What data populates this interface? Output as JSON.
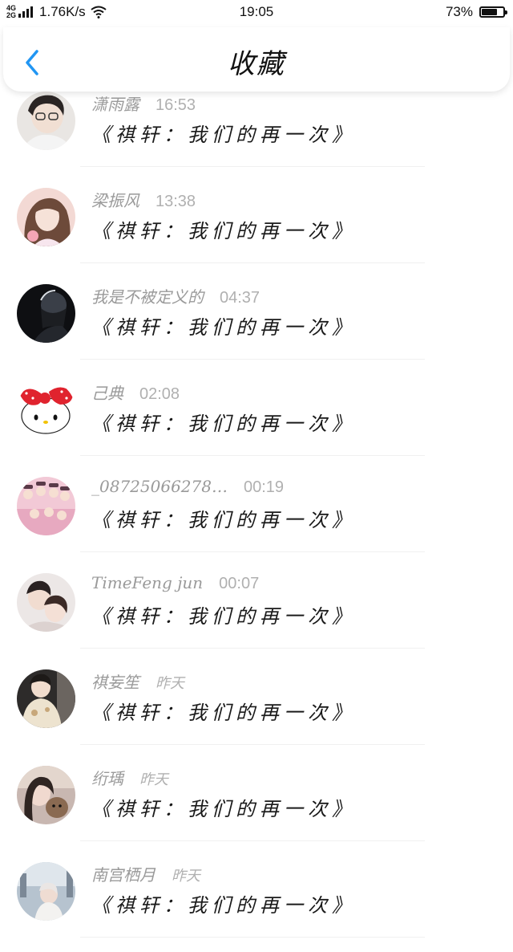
{
  "status_bar": {
    "network_top": "4G",
    "network_bottom": "2G",
    "speed": "1.76K/s",
    "time": "19:05",
    "battery_percent": "73%",
    "battery_level": 0.73
  },
  "header": {
    "title": "收藏",
    "accent_color": "#2196F3"
  },
  "items": [
    {
      "name": "潇雨露",
      "time": "16:53",
      "title": "《祺轩：我们的再一次》",
      "avatar": "avatar-boy-glasses"
    },
    {
      "name": "梁振风",
      "time": "13:38",
      "title": "《祺轩：我们的再一次》",
      "avatar": "avatar-girl-pink"
    },
    {
      "name": "我是不被定义的",
      "time": "04:37",
      "title": "《祺轩：我们的再一次》",
      "avatar": "avatar-dark-silhouette"
    },
    {
      "name": "己典",
      "time": "02:08",
      "title": "《祺轩：我们的再一次》",
      "avatar": "avatar-hello-kitty"
    },
    {
      "name": "_08725066278…",
      "time": "00:19",
      "title": "《祺轩：我们的再一次》",
      "avatar": "avatar-group-pink"
    },
    {
      "name": "TimeFeng jun",
      "time": "00:07",
      "title": "《祺轩：我们的再一次》",
      "avatar": "avatar-couple"
    },
    {
      "name": "祺妄笙",
      "time": "昨天",
      "title": "《祺轩：我们的再一次》",
      "avatar": "avatar-boy-cream"
    },
    {
      "name": "绗瑀",
      "time": "昨天",
      "title": "《祺轩：我们的再一次》",
      "avatar": "avatar-girl-dog"
    },
    {
      "name": "南宫栖月",
      "time": "昨天",
      "title": "《祺轩：我们的再一次》",
      "avatar": "avatar-street"
    }
  ]
}
